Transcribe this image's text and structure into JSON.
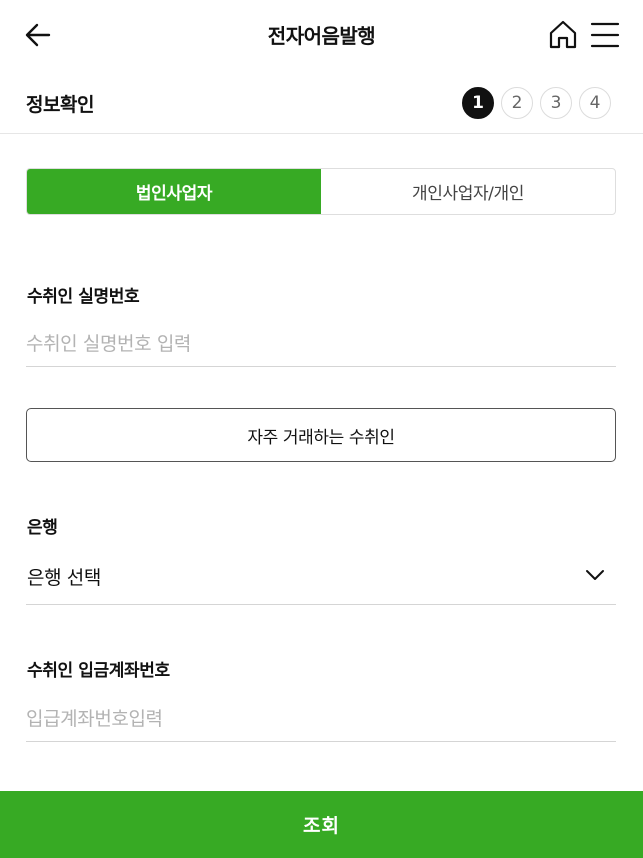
{
  "header": {
    "title": "전자어음발행",
    "back_icon": "arrow-left-icon",
    "home_icon": "home-icon",
    "menu_icon": "hamburger-menu-icon"
  },
  "stepbar": {
    "title": "정보확인",
    "steps": [
      "1",
      "2",
      "3",
      "4"
    ],
    "active_step": "1"
  },
  "tabs": {
    "corporate": "법인사업자",
    "individual": "개인사업자/개인",
    "selected": "법인사업자"
  },
  "recipient_id": {
    "label": "수취인 실명번호",
    "placeholder": "수취인 실명번호 입력",
    "value": ""
  },
  "frequent_button": {
    "label": "자주 거래하는 수취인"
  },
  "bank": {
    "label": "은행",
    "value": "은행 선택",
    "chevron_icon": "chevron-down-icon"
  },
  "account": {
    "label": "수취인 입금계좌번호",
    "placeholder": "입급계좌번호입력",
    "value": ""
  },
  "submit": {
    "label": "조회"
  },
  "colors": {
    "accent": "#37aa24",
    "active_step": "#111111",
    "placeholder": "#b3b3b3"
  }
}
